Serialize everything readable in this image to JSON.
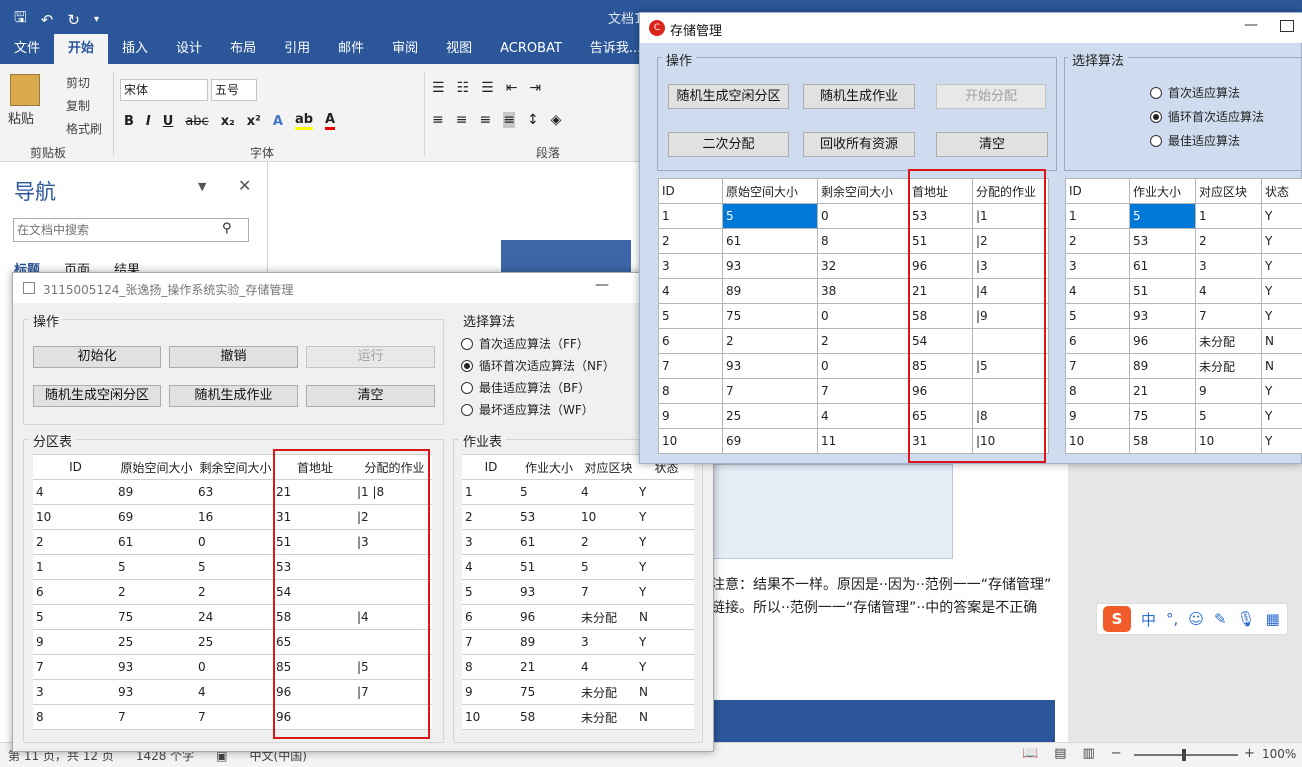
{
  "word": {
    "title_partial": "文档1 - Word",
    "tabs": [
      "文件",
      "开始",
      "插入",
      "设计",
      "布局",
      "引用",
      "邮件",
      "审阅",
      "视图",
      "ACROBAT",
      "告诉我..."
    ],
    "clipboard": {
      "paste": "粘贴",
      "cut": "剪切",
      "copy": "复制",
      "format_painter": "格式刷",
      "group": "剪贴板"
    },
    "font": {
      "name": "宋体",
      "size": "五号",
      "group": "字体"
    },
    "paragraph_group": "段落",
    "nav": {
      "title": "导航",
      "search_placeholder": "在文档中搜索",
      "tabs": [
        "标题",
        "页面",
        "结果"
      ]
    },
    "doc_text": {
      "line1": "注意：结果不一样。原因是··因为··范例一一“存储管理”",
      "line2": "链接。所以··范例一一“存储管理”··中的答案是不正确"
    },
    "status": {
      "page": "第 11 页，共 12 页",
      "words": "1428 个字",
      "lang": "中文(中国)",
      "zoom": "100%"
    },
    "ime": {
      "lang": "中"
    }
  },
  "back_window": {
    "title": "3115005124_张逸扬_操作系统实验_存储管理",
    "ops_label": "操作",
    "buttons": {
      "init": "初始化",
      "undo": "撤销",
      "run": "运行",
      "gen_partition": "随机生成空闲分区",
      "gen_job": "随机生成作业",
      "clear": "清空"
    },
    "algo_label": "选择算法",
    "algos": [
      "首次适应算法（FF）",
      "循环首次适应算法（NF）",
      "最佳适应算法（BF）",
      "最坏适应算法（WF）"
    ],
    "partition_label": "分区表",
    "partition_headers": [
      "ID",
      "原始空间大小",
      "剩余空间大小",
      "首地址",
      "分配的作业"
    ],
    "partitions": [
      [
        "4",
        "89",
        "63",
        "21",
        "|1 |8"
      ],
      [
        "10",
        "69",
        "16",
        "31",
        "|2"
      ],
      [
        "2",
        "61",
        "0",
        "51",
        "|3"
      ],
      [
        "1",
        "5",
        "5",
        "53",
        ""
      ],
      [
        "6",
        "2",
        "2",
        "54",
        ""
      ],
      [
        "5",
        "75",
        "24",
        "58",
        "|4"
      ],
      [
        "9",
        "25",
        "25",
        "65",
        ""
      ],
      [
        "7",
        "93",
        "0",
        "85",
        "|5"
      ],
      [
        "3",
        "93",
        "4",
        "96",
        "|7"
      ],
      [
        "8",
        "7",
        "7",
        "96",
        ""
      ]
    ],
    "job_label": "作业表",
    "job_headers": [
      "ID",
      "作业大小",
      "对应区块",
      "状态"
    ],
    "jobs": [
      [
        "1",
        "5",
        "4",
        "Y"
      ],
      [
        "2",
        "53",
        "10",
        "Y"
      ],
      [
        "3",
        "61",
        "2",
        "Y"
      ],
      [
        "4",
        "51",
        "5",
        "Y"
      ],
      [
        "5",
        "93",
        "7",
        "Y"
      ],
      [
        "6",
        "96",
        "未分配",
        "N"
      ],
      [
        "7",
        "89",
        "3",
        "Y"
      ],
      [
        "8",
        "21",
        "4",
        "Y"
      ],
      [
        "9",
        "75",
        "未分配",
        "N"
      ],
      [
        "10",
        "58",
        "未分配",
        "N"
      ]
    ]
  },
  "front_window": {
    "title": "存储管理",
    "ops_label": "操作",
    "buttons": {
      "gen_partition": "随机生成空闲分区",
      "gen_job": "随机生成作业",
      "start": "开始分配",
      "second": "二次分配",
      "recycle": "回收所有资源",
      "clear": "清空"
    },
    "algo_label": "选择算法",
    "algos": [
      "首次适应算法",
      "循环首次适应算法",
      "最佳适应算法"
    ],
    "partition_headers": [
      "ID",
      "原始空间大小",
      "剩余空间大小",
      "首地址",
      "分配的作业"
    ],
    "partitions": [
      [
        "1",
        "5",
        "0",
        "53",
        "|1"
      ],
      [
        "2",
        "61",
        "8",
        "51",
        "|2"
      ],
      [
        "3",
        "93",
        "32",
        "96",
        "|3"
      ],
      [
        "4",
        "89",
        "38",
        "21",
        "|4"
      ],
      [
        "5",
        "75",
        "0",
        "58",
        "|9"
      ],
      [
        "6",
        "2",
        "2",
        "54",
        ""
      ],
      [
        "7",
        "93",
        "0",
        "85",
        "|5"
      ],
      [
        "8",
        "7",
        "7",
        "96",
        ""
      ],
      [
        "9",
        "25",
        "4",
        "65",
        "|8"
      ],
      [
        "10",
        "69",
        "11",
        "31",
        "|10"
      ]
    ],
    "job_headers": [
      "ID",
      "作业大小",
      "对应区块",
      "状态"
    ],
    "jobs": [
      [
        "1",
        "5",
        "1",
        "Y"
      ],
      [
        "2",
        "53",
        "2",
        "Y"
      ],
      [
        "3",
        "61",
        "3",
        "Y"
      ],
      [
        "4",
        "51",
        "4",
        "Y"
      ],
      [
        "5",
        "93",
        "7",
        "Y"
      ],
      [
        "6",
        "96",
        "未分配",
        "N"
      ],
      [
        "7",
        "89",
        "未分配",
        "N"
      ],
      [
        "8",
        "21",
        "9",
        "Y"
      ],
      [
        "9",
        "75",
        "5",
        "Y"
      ],
      [
        "10",
        "58",
        "10",
        "Y"
      ]
    ]
  },
  "colors": {
    "word_blue": "#2b579a",
    "selection": "#0078d7",
    "highlight_border": "#d9181a",
    "window_bg": "#f0f0f0"
  }
}
